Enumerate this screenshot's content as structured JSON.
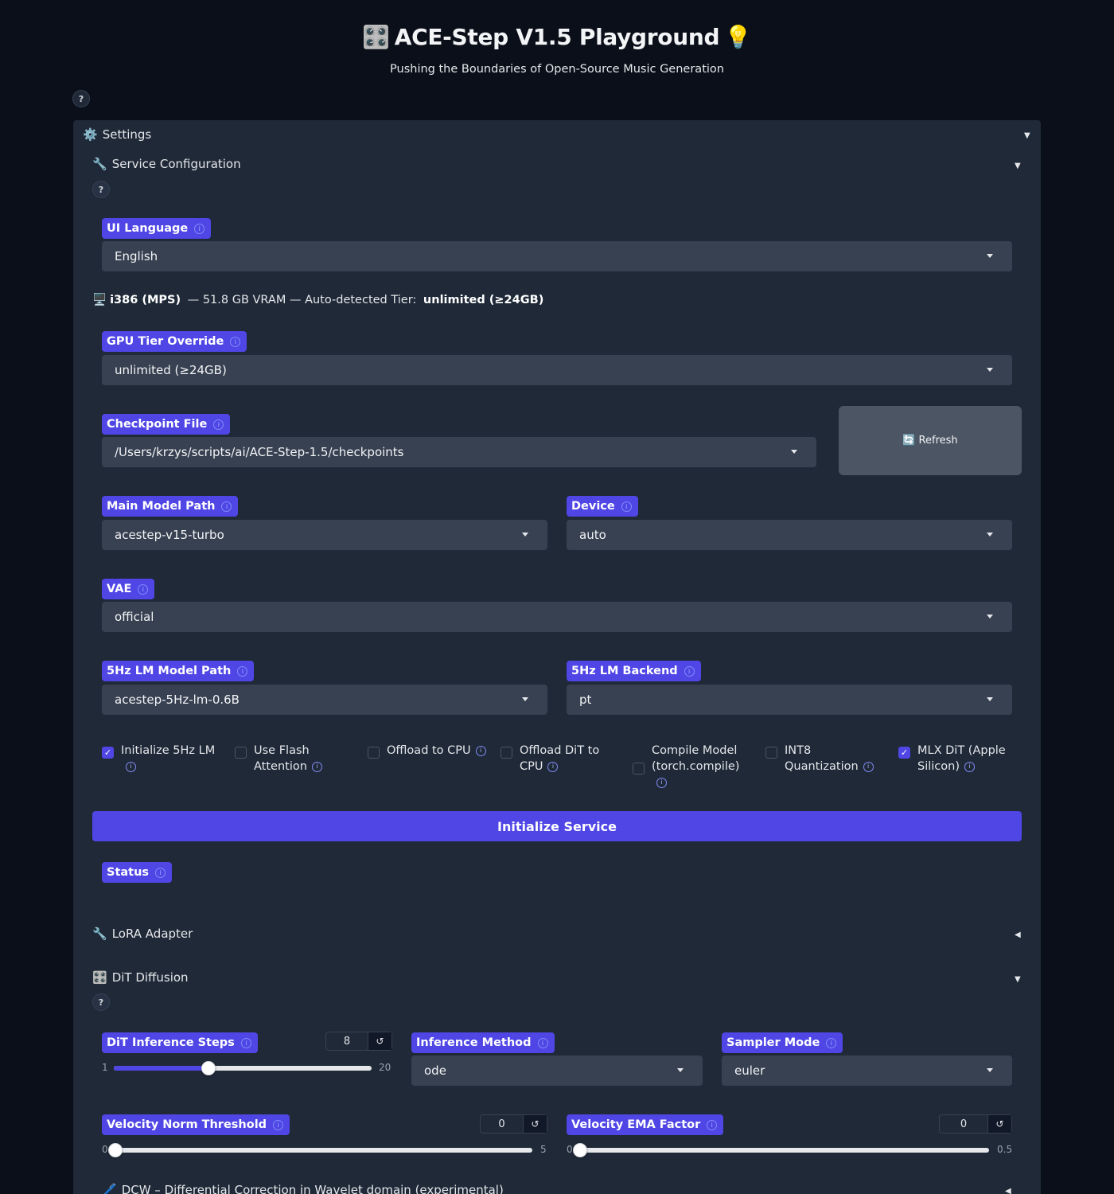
{
  "header": {
    "title": "ACE-Step V1.5 Playground",
    "subtitle": "Pushing the Boundaries of Open-Source Music Generation",
    "help": "?"
  },
  "settings": {
    "title": "Settings",
    "service_config": {
      "title": "Service Configuration",
      "help": "?",
      "ui_language": {
        "label": "UI Language",
        "value": "English"
      },
      "gpu_info": {
        "device": "i386 (MPS)",
        "middle": " — 51.8 GB VRAM — Auto-detected Tier: ",
        "tier": "unlimited (≥24GB)"
      },
      "gpu_tier_override": {
        "label": "GPU Tier Override",
        "value": "unlimited (≥24GB)"
      },
      "checkpoint_file": {
        "label": "Checkpoint File",
        "value": "/Users/krzys/scripts/ai/ACE-Step-1.5/checkpoints"
      },
      "refresh_label": "Refresh",
      "main_model_path": {
        "label": "Main Model Path",
        "value": "acestep-v15-turbo"
      },
      "device": {
        "label": "Device",
        "value": "auto"
      },
      "vae": {
        "label": "VAE",
        "value": "official"
      },
      "lm_model_path": {
        "label": "5Hz LM Model Path",
        "value": "acestep-5Hz-lm-0.6B"
      },
      "lm_backend": {
        "label": "5Hz LM Backend",
        "value": "pt"
      },
      "checkboxes": [
        {
          "label": "Initialize 5Hz LM",
          "checked": true
        },
        {
          "label": "Use Flash Attention",
          "checked": false
        },
        {
          "label": "Offload to CPU",
          "checked": false
        },
        {
          "label": "Offload DiT to CPU",
          "checked": false
        },
        {
          "label": "Compile Model (torch.compile)",
          "checked": false
        },
        {
          "label": "INT8 Quantization",
          "checked": false
        },
        {
          "label": "MLX DiT (Apple Silicon)",
          "checked": true
        }
      ],
      "init_button": "Initialize Service",
      "status_label": "Status"
    },
    "lora": {
      "title": "LoRA Adapter"
    },
    "dit": {
      "title": "DiT Diffusion",
      "help": "?",
      "inference_steps": {
        "label": "DiT Inference Steps",
        "value": "8",
        "min": "1",
        "max": "20",
        "fraction": 0.3684
      },
      "inference_method": {
        "label": "Inference Method",
        "value": "ode"
      },
      "sampler_mode": {
        "label": "Sampler Mode",
        "value": "euler"
      },
      "velocity_norm": {
        "label": "Velocity Norm Threshold",
        "value": "0",
        "min": "0",
        "max": "5",
        "fraction": 0
      },
      "velocity_ema": {
        "label": "Velocity EMA Factor",
        "value": "0",
        "min": "0",
        "max": "0.5",
        "fraction": 0
      }
    },
    "dcw": {
      "title": "DCW – Differential Correction in Wavelet domain (experimental)"
    }
  },
  "colors": {
    "accent": "#4f46e5",
    "background": "#0b0f19",
    "panel": "#1f2937",
    "input": "#374151"
  }
}
